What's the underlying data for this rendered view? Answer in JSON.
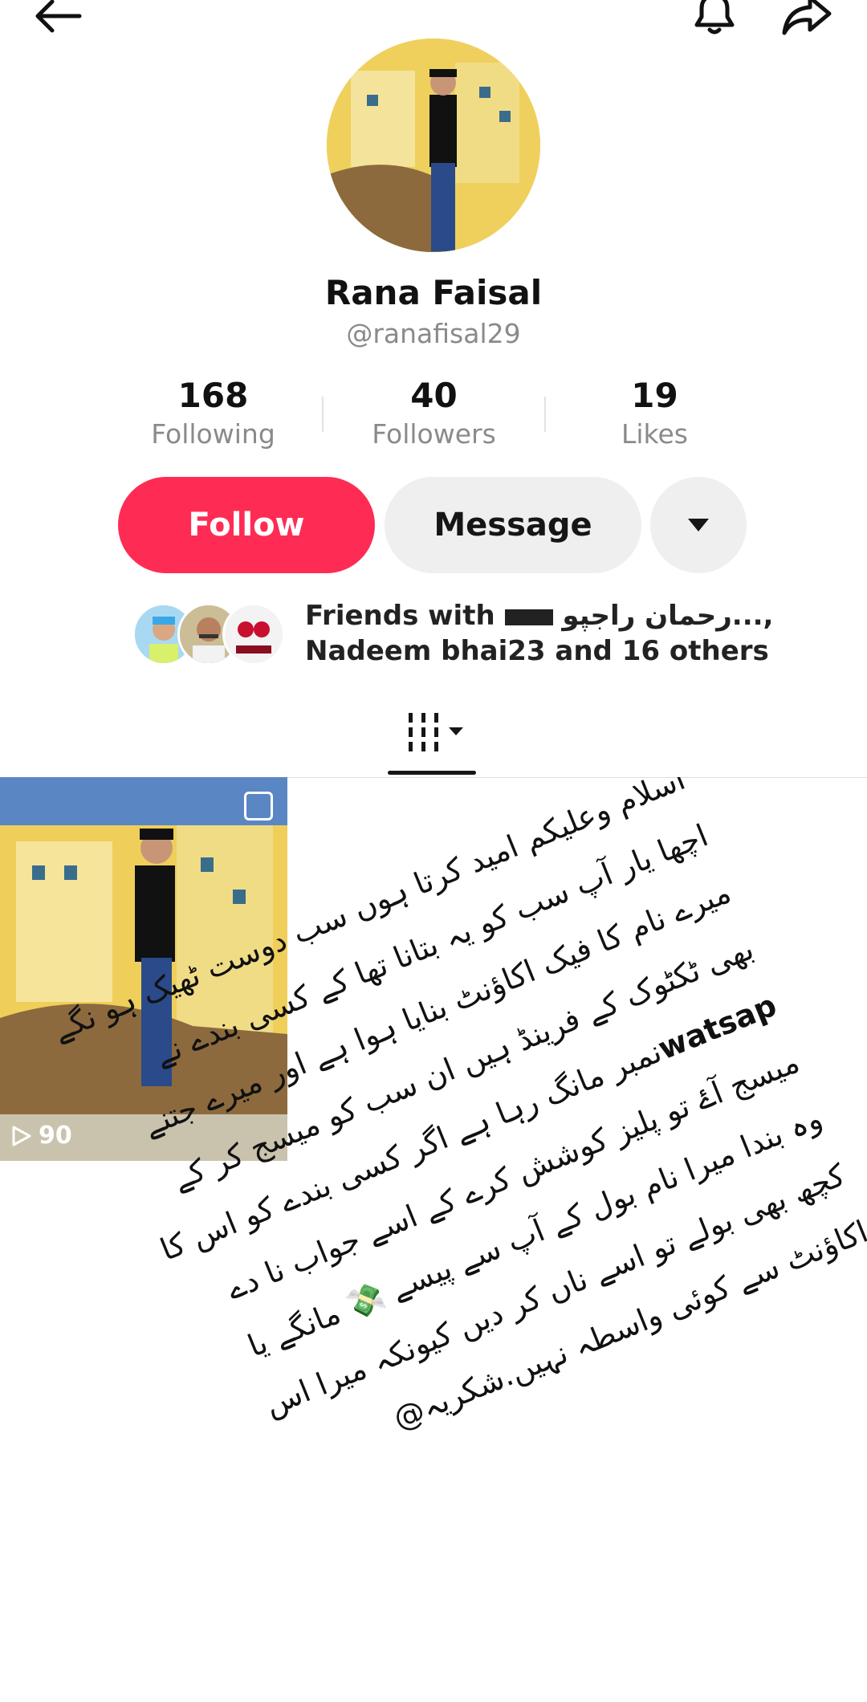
{
  "profile": {
    "name": "Rana Faisal",
    "handle": "@ranafisal29"
  },
  "stats": [
    {
      "value": "168",
      "label": "Following"
    },
    {
      "value": "40",
      "label": "Followers"
    },
    {
      "value": "19",
      "label": "Likes"
    }
  ],
  "actions": {
    "follow": "Follow",
    "message": "Message"
  },
  "friends": {
    "line1_prefix": "Friends with",
    "line1_name": "رحمان راجپو...",
    "line1_suffix": ",",
    "line2": "Nadeem bhai23 and 16 others"
  },
  "video": {
    "plays": "90"
  },
  "note_lines": [
    "اسلام وعلیکم امید کرتا ہوں سب دوست ٹھیک ہو نگے",
    "اچھا یار آپ سب کو یہ بتانا تھا کے کسی بندے نے",
    "میرے نام کا فیک اکاؤنٹ بنایا ہوا ہے اور میرے جتنے",
    "بھی ٹکٹوک کے فرینڈ ہیں  ان سب کو میسج کر کے",
    "نمبر مانگ رہا ہے اگر کسی بندے کو اس کا",
    "میسج آۓ تو پلیز  کوشش کرے کے اسے جواب نا دے",
    "وہ بندا میرا نام بول کے آپ سے پیسے 💸 مانگے یا",
    "کچھ بھی بولے تو اسے ناں کر دیں کیونکہ میرا اس",
    "اکاؤنٹ سے کوئی واسطہ نہیں.شکریہ@"
  ],
  "note_watsap": "watsap"
}
